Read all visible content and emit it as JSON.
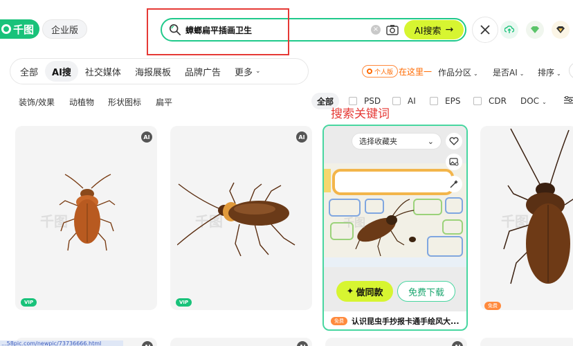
{
  "header": {
    "logo": "千图",
    "edition": "企业版",
    "search_value": "蟑螂扁平插画卫生",
    "clear_glyph": "×",
    "ai_search_label": "AI搜索",
    "ai_search_arrow": "→"
  },
  "category_nav": {
    "items": [
      "全部",
      "AI搜",
      "社交媒体",
      "海报展板",
      "品牌广告",
      "更多"
    ],
    "active_index": 1,
    "more_chevron": "⌄"
  },
  "filters": {
    "personal_badge": "个人版",
    "here_link": "在这里一",
    "area": "作品分区",
    "is_ai": "是否AI",
    "sort": "排序",
    "chevron": "⌄"
  },
  "sub_tags": [
    "装饰/效果",
    "动植物",
    "形状图标",
    "扁平"
  ],
  "formats": {
    "all": "全部",
    "options": [
      "PSD",
      "AI",
      "EPS",
      "CDR"
    ],
    "doc": "DOC"
  },
  "annotation_label": "搜索关键词",
  "cards": {
    "ai_badge": "AI",
    "vip_badge": "VIP",
    "free_badge": "免费",
    "watermark": "千图"
  },
  "highlight_card": {
    "collect_placeholder": "选择收藏夹",
    "make_same": "做同款",
    "free_download": "免费下载",
    "free_badge": "免费",
    "title": "认识昆虫手抄报卡通手绘风大..."
  },
  "status_url": "...58pic.com/newpic/73736666.html",
  "colors": {
    "brand_green": "#19c27a",
    "ai_yellow": "#d7f531",
    "annotation_red": "#e53935",
    "highlight_border": "#47d6a0"
  }
}
